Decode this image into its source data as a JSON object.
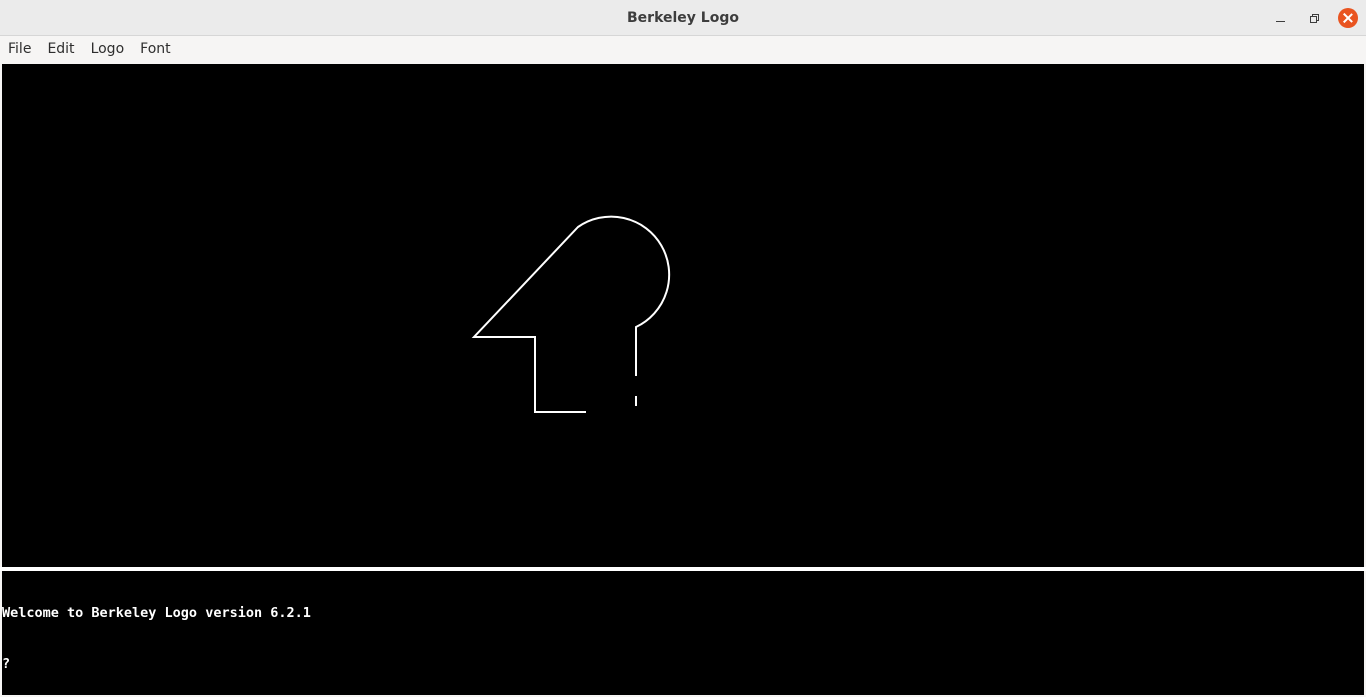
{
  "window": {
    "title": "Berkeley Logo"
  },
  "menu": {
    "items": [
      {
        "label": "File"
      },
      {
        "label": "Edit"
      },
      {
        "label": "Logo"
      },
      {
        "label": "Font"
      }
    ]
  },
  "colors": {
    "canvas_bg": "#000000",
    "pen": "#ffffff",
    "close_button": "#e95420"
  },
  "window_controls": {
    "minimize": "minimize-icon",
    "maximize": "restore-icon",
    "close": "close-icon"
  },
  "console": {
    "lines": [
      "Welcome to Berkeley Logo version 6.2.1",
      "?",
      "?"
    ]
  }
}
